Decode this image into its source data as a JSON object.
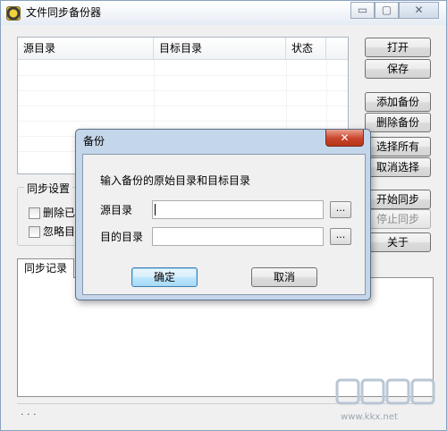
{
  "window": {
    "title": "文件同步备份器",
    "controls": {
      "minimize": "▭",
      "restore": "▢",
      "close": "✕"
    }
  },
  "list": {
    "columns": [
      "源目录",
      "目标目录",
      "状态"
    ]
  },
  "buttons": {
    "open": "打开",
    "save": "保存",
    "add_backup": "添加备份",
    "delete_backup": "删除备份",
    "select_all": "选择所有",
    "cancel_select": "取消选择",
    "start_sync": "开始同步",
    "stop_sync": "停止同步",
    "about": "关于"
  },
  "sync_settings": {
    "title": "同步设置",
    "option1": "删除已",
    "option2": "忽略目"
  },
  "log_tab": {
    "label": "同步记录"
  },
  "statusbar": {
    "text": ". . ."
  },
  "dialog": {
    "title": "备份",
    "close": "✕",
    "prompt": "输入备份的原始目录和目标目录",
    "source_label": "源目录",
    "source_value": "",
    "target_label": "目的目录",
    "target_value": "",
    "browse": "...",
    "ok": "确定",
    "cancel": "取消"
  },
  "watermark": {
    "text": "www.kkx.net"
  },
  "colors": {
    "dialog_frame": "#c4d6ea",
    "close_red": "#c8442b",
    "ok_blue": "#3c7fb1"
  }
}
